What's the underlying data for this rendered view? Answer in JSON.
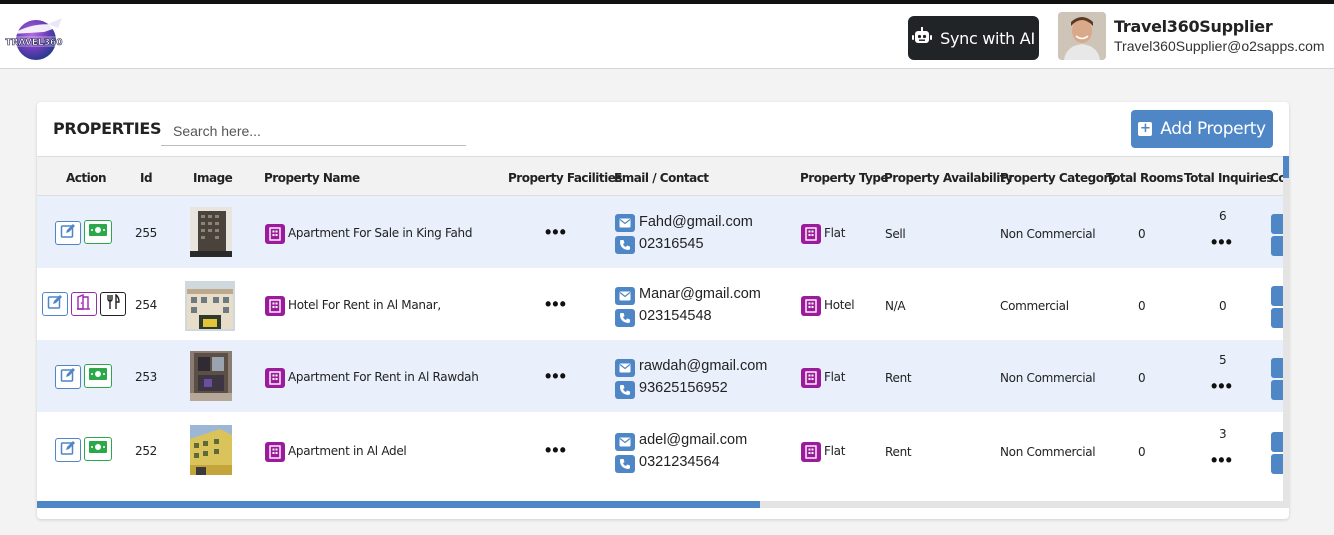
{
  "header": {
    "logo_text": "TRAVEL360",
    "sync_label": "Sync with AI",
    "user_name": "Travel360Supplier",
    "user_email": "Travel360Supplier@o2sapps.com"
  },
  "page": {
    "title": "PROPERTIES",
    "search_placeholder": "Search here...",
    "add_label": "Add Property"
  },
  "columns": {
    "action": "Action",
    "id": "Id",
    "image": "Image",
    "name": "Property Name",
    "facilities": "Property Facilities",
    "contact": "Email / Contact",
    "type": "Property Type",
    "availability": "Property Availability",
    "category": "Property Category",
    "rooms": "Total Rooms",
    "inquiries": "Total Inquiries",
    "cut": "Co"
  },
  "rows": [
    {
      "id": "255",
      "name": "Apartment For Sale in King Fahd",
      "facilities": "•••",
      "email": "Fahd@gmail.com",
      "phone": "02316545",
      "type": "Flat",
      "availability": "Sell",
      "category": "Non Commercial",
      "rooms": "0",
      "inquiries": "6",
      "inquiries_more": "•••"
    },
    {
      "id": "254",
      "name": "Hotel For Rent in Al Manar,",
      "facilities": "•••",
      "email": "Manar@gmail.com",
      "phone": "023154548",
      "type": "Hotel",
      "availability": "N/A",
      "category": "Commercial",
      "rooms": "0",
      "inquiries": "0",
      "inquiries_more": ""
    },
    {
      "id": "253",
      "name": "Apartment For Rent in Al Rawdah",
      "facilities": "•••",
      "email": "rawdah@gmail.com",
      "phone": "93625156952",
      "type": "Flat",
      "availability": "Rent",
      "category": "Non Commercial",
      "rooms": "0",
      "inquiries": "5",
      "inquiries_more": "•••"
    },
    {
      "id": "252",
      "name": "Apartment in Al Adel",
      "facilities": "•••",
      "email": "adel@gmail.com",
      "phone": "0321234564",
      "type": "Flat",
      "availability": "Rent",
      "category": "Non Commercial",
      "rooms": "0",
      "inquiries": "3",
      "inquiries_more": "•••"
    }
  ],
  "scroll": {
    "horizontal_fraction": 0.58
  },
  "colors": {
    "accent": "#4f86c6",
    "property_badge": "#9c1a9c",
    "money_green": "#2aa84a",
    "dark_button": "#212427"
  }
}
